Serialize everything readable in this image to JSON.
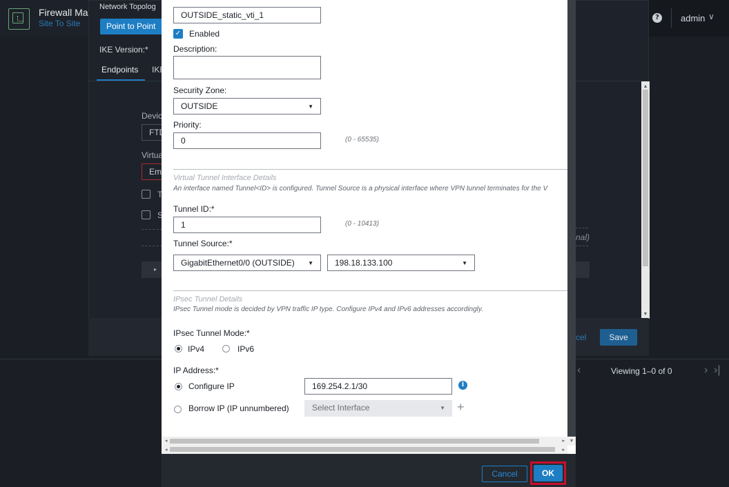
{
  "colors": {
    "accent": "#1e7ec4",
    "error": "#c8102e",
    "success_logo": "#6aa77a"
  },
  "app": {
    "title": "Firewall Ma",
    "subtitle": "Site To Site",
    "user": "admin",
    "user_chevron": "∨",
    "help": "?"
  },
  "wizard": {
    "header_title": "Network Topolog",
    "topology_button": "Point to Point",
    "ike_version_label": "IKE Version:*",
    "tabs": [
      "Endpoints",
      "IKE"
    ],
    "device_label": "Devic",
    "device_value": "FTD",
    "virtual_label": "Virtua",
    "virtual_value": "Em",
    "check_t": "T",
    "check_s": "S",
    "optional_fragment": "nal)",
    "cancel_fragment": "cel",
    "save_label": "Save",
    "expand_icon": "▸"
  },
  "table_footer": {
    "viewing": "Viewing 1–0 of 0",
    "prev": "‹",
    "next": "›",
    "last": "›|"
  },
  "modal": {
    "name_value": "OUTSIDE_static_vti_1",
    "enabled_label": "Enabled",
    "enabled_checked": true,
    "description_label": "Description:",
    "description_value": "",
    "security_zone_label": "Security Zone:",
    "security_zone_value": "OUTSIDE",
    "priority_label": "Priority:",
    "priority_value": "0",
    "priority_hint": "(0 - 65535)",
    "vti_section_title": "Virtual Tunnel Interface Details",
    "vti_section_desc": "An interface named Tunnel<ID> is configured. Tunnel Source is a physical interface where VPN tunnel terminates for the V",
    "tunnel_id_label": "Tunnel ID:*",
    "tunnel_id_value": "1",
    "tunnel_id_hint": "(0 - 10413)",
    "tunnel_source_label": "Tunnel Source:*",
    "tunnel_source_interface": "GigabitEthernet0/0 (OUTSIDE)",
    "tunnel_source_ip": "198.18.133.100",
    "ipsec_section_title": "IPsec Tunnel Details",
    "ipsec_section_desc": "IPsec Tunnel mode is decided by VPN traffic IP type. Configure IPv4 and IPv6 addresses accordingly.",
    "ipsec_mode_label": "IPsec Tunnel Mode:*",
    "mode_ipv4": "IPv4",
    "mode_ipv6": "IPv6",
    "mode_selected": "IPv4",
    "ip_address_label": "IP Address:*",
    "configure_ip_label": "Configure IP",
    "configure_ip_value": "169.254.2.1/30",
    "borrow_ip_label": "Borrow IP (IP unnumbered)",
    "select_interface_placeholder": "Select Interface",
    "cancel_label": "Cancel",
    "ok_label": "OK",
    "checkmark": "✓",
    "caret": "▼",
    "plus": "+",
    "info": "i"
  }
}
